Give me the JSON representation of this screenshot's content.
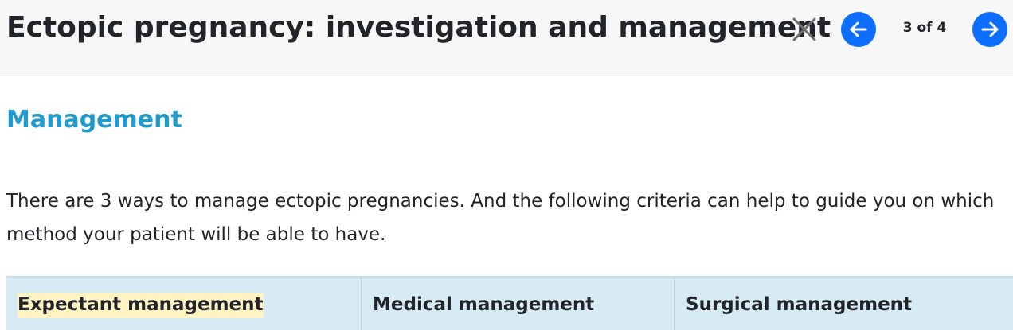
{
  "header": {
    "title": "Ectopic pregnancy: investigation and management",
    "close_icon": "close-icon",
    "prev_icon": "arrow-left-icon",
    "next_icon": "arrow-right-icon",
    "counter": "3 of 4",
    "accent_color": "#0d6efd"
  },
  "content": {
    "heading": "Management",
    "heading_color": "#1f9bcf",
    "paragraph": "There are 3 ways to manage ectopic pregnancies. And the following criteria can help to guide you on which method your patient will be able to have."
  },
  "table": {
    "header_bg": "#d7ebf4",
    "highlight_color": "#fff3c4",
    "columns": [
      "Expectant management",
      "Medical management",
      "Surgical management"
    ]
  }
}
